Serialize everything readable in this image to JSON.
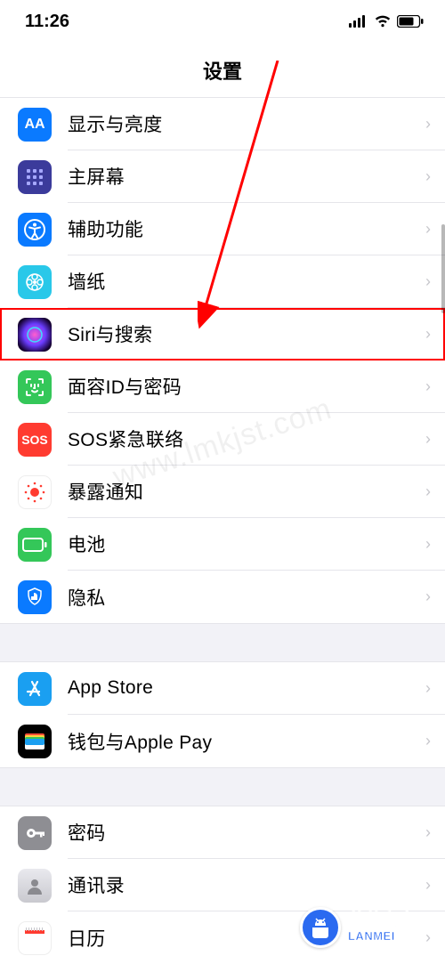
{
  "status": {
    "time": "11:26"
  },
  "header": {
    "title": "设置"
  },
  "groups": [
    {
      "items": [
        {
          "id": "display",
          "label": "显示与亮度"
        },
        {
          "id": "home",
          "label": "主屏幕"
        },
        {
          "id": "access",
          "label": "辅助功能"
        },
        {
          "id": "wallpaper",
          "label": "墙纸"
        },
        {
          "id": "siri",
          "label": "Siri与搜索",
          "highlight": true
        },
        {
          "id": "faceid",
          "label": "面容ID与密码"
        },
        {
          "id": "sos",
          "label": "SOS紧急联络"
        },
        {
          "id": "exposure",
          "label": "暴露通知"
        },
        {
          "id": "battery",
          "label": "电池"
        },
        {
          "id": "privacy",
          "label": "隐私"
        }
      ]
    },
    {
      "items": [
        {
          "id": "appstore",
          "label": "App Store"
        },
        {
          "id": "wallet",
          "label": "钱包与Apple Pay"
        }
      ]
    },
    {
      "items": [
        {
          "id": "passwords",
          "label": "密码"
        },
        {
          "id": "contacts",
          "label": "通讯录"
        },
        {
          "id": "calendar",
          "label": "日历"
        }
      ]
    }
  ],
  "watermark": {
    "brand_line1": "蓝莓安卓网",
    "brand_line2": "LANMEI",
    "url": "www.lmkjst.com"
  }
}
